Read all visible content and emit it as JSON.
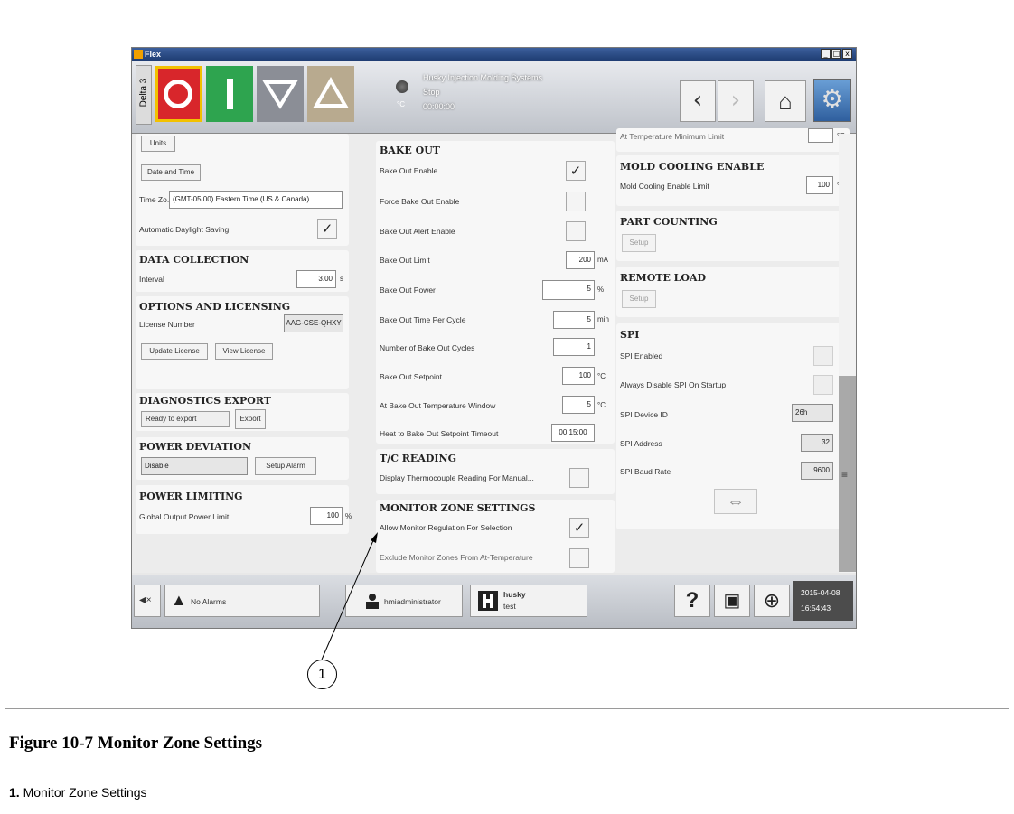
{
  "window": {
    "title": "Flex",
    "machine_tab": "Delta 3",
    "company": "Husky Injection Molding Systems",
    "state": "Stop",
    "temp_unit": "°C",
    "timer": "00:00:00",
    "controls": {
      "minimize": "_",
      "restore": "□",
      "close": "x"
    }
  },
  "header_icons": {
    "stop": "stop-icon",
    "start": "start-icon",
    "lower": "triangle-down-icon",
    "raise": "triangle-up-icon",
    "back": "‹",
    "forward": "›",
    "home": "⌂",
    "settings": "⚙"
  },
  "left": {
    "units_btn": "Units",
    "date_time_btn": "Date and Time",
    "timezone_label": "Time Zo...",
    "timezone_value": "(GMT-05:00) Eastern Time (US & Canada)",
    "dst_label": "Automatic Daylight Saving",
    "dst_checked": "✓",
    "data_collection": {
      "title": "DATA COLLECTION",
      "interval_label": "Interval",
      "interval_value": "3.00",
      "interval_unit": "s"
    },
    "options": {
      "title": "OPTIONS AND LICENSING",
      "license_label": "License Number",
      "license_value": "AAG-CSE-QHXY",
      "update_btn": "Update License",
      "view_btn": "View License"
    },
    "diagnostics": {
      "title": "DIAGNOSTICS EXPORT",
      "status": "Ready to export",
      "export_btn": "Export"
    },
    "power_deviation": {
      "title": "POWER DEVIATION",
      "value": "Disable",
      "setup_btn": "Setup Alarm"
    },
    "power_limiting": {
      "title": "POWER LIMITING",
      "label": "Global Output Power Limit",
      "value": "100",
      "unit": "%"
    }
  },
  "middle": {
    "bake_out": {
      "title": "BAKE OUT",
      "enable_label": "Bake Out Enable",
      "enable_checked": "✓",
      "force_label": "Force Bake Out Enable",
      "alert_label": "Bake Out Alert Enable",
      "limit_label": "Bake Out Limit",
      "limit_value": "200",
      "limit_unit": "mA",
      "power_label": "Bake Out Power",
      "power_value": "5",
      "power_unit": "%",
      "time_label": "Bake Out Time Per Cycle",
      "time_value": "5",
      "time_unit": "min",
      "cycles_label": "Number of Bake Out Cycles",
      "cycles_value": "1",
      "setpoint_label": "Bake Out Setpoint",
      "setpoint_value": "100",
      "setpoint_unit": "°C",
      "window_label": "At Bake Out Temperature Window",
      "window_value": "5",
      "window_unit": "°C",
      "timeout_label": "Heat to Bake Out Setpoint Timeout",
      "timeout_value": "00:15:00"
    },
    "tc_reading": {
      "title": "T/C READING",
      "label": "Display Thermocouple Reading For Manual..."
    },
    "monitor": {
      "title": "MONITOR ZONE SETTINGS",
      "allow_label": "Allow Monitor Regulation For Selection",
      "allow_checked": "✓",
      "exclude_label": "Exclude Monitor Zones From At-Temperature"
    }
  },
  "right": {
    "at_temp_label": "At Temperature Minimum Limit",
    "at_temp_unit": "°C",
    "mold_cooling": {
      "title": "MOLD COOLING ENABLE",
      "label": "Mold Cooling Enable Limit",
      "value": "100",
      "unit": "°C"
    },
    "part_counting": {
      "title": "PART COUNTING",
      "setup_btn": "Setup"
    },
    "remote_load": {
      "title": "REMOTE LOAD",
      "setup_btn": "Setup"
    },
    "spi": {
      "title": "SPI",
      "enabled_label": "SPI Enabled",
      "disable_label": "Always Disable SPI On Startup",
      "device_label": "SPI Device ID",
      "device_value": "26h",
      "address_label": "SPI Address",
      "address_value": "32",
      "baud_label": "SPI Baud Rate",
      "baud_value": "9600",
      "action_icon": "⇔"
    }
  },
  "scrollbar": {
    "grip": "≡"
  },
  "bottom": {
    "mute_icon": "◀×",
    "alarm_icon": "▲",
    "alarm_text": "No Alarms",
    "user": "hmiadministrator",
    "mold_name": "husky",
    "mold_sub": "test",
    "help": "?",
    "screenshot_icon": "▣",
    "globe_icon": "⊕",
    "date": "2015-04-08",
    "time": "16:54:43"
  },
  "figure": {
    "callout_number": "1",
    "caption": "Figure 10-7 Monitor Zone Settings",
    "legend_number": "1.",
    "legend_text": "Monitor Zone Settings"
  }
}
